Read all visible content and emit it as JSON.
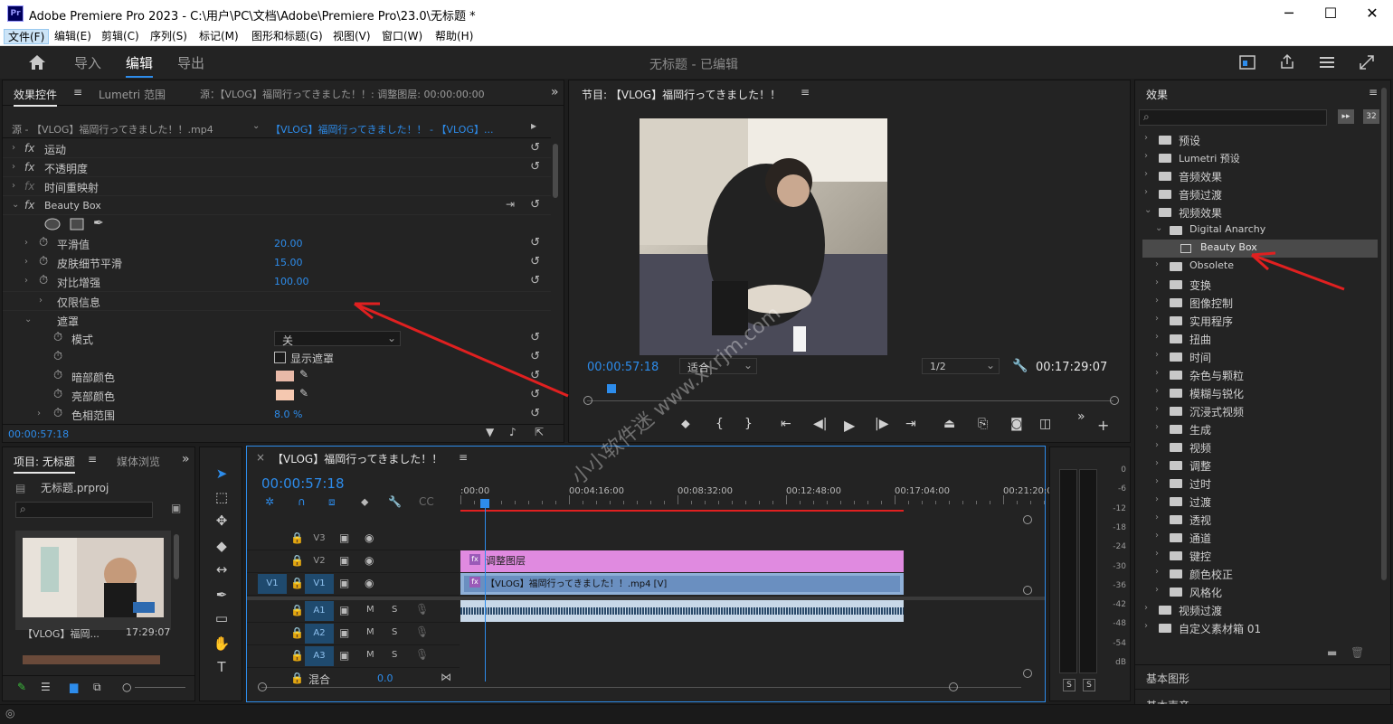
{
  "window": {
    "title": "Adobe Premiere Pro 2023 - C:\\用户\\PC\\文档\\Adobe\\Premiere Pro\\23.0\\无标题 *",
    "app_badge": "Pr"
  },
  "menu": [
    "文件(F)",
    "编辑(E)",
    "剪辑(C)",
    "序列(S)",
    "标记(M)",
    "图形和标题(G)",
    "视图(V)",
    "窗口(W)",
    "帮助(H)"
  ],
  "workspace": {
    "tabs": [
      "导入",
      "编辑",
      "导出"
    ],
    "active_tab": "编辑",
    "project_status": "无标题 - 已编辑"
  },
  "effect_controls": {
    "tabs": [
      "效果控件",
      "Lumetri 范围",
      "源：【VLOG】福岡行ってきました！！: 调整图层: 00:00:00:00"
    ],
    "source_clip": "源 - 【VLOG】福岡行ってきました！！.mp4",
    "sequence_clip": "【VLOG】福岡行ってきました！！ - 【VLOG】...",
    "effects": [
      "运动",
      "不透明度",
      "时间重映射",
      "Beauty Box"
    ],
    "params": [
      {
        "label": "平滑值",
        "value": "20.00"
      },
      {
        "label": "皮肤细节平滑",
        "value": "15.00"
      },
      {
        "label": "对比增强",
        "value": "100.00"
      },
      {
        "label": "仅限信息",
        "value": ""
      },
      {
        "label": "遮罩",
        "value": ""
      },
      {
        "label": "模式",
        "value": "关"
      },
      {
        "label": "",
        "value": "显示遮罩"
      },
      {
        "label": "暗部颜色",
        "value": ""
      },
      {
        "label": "亮部颜色",
        "value": ""
      },
      {
        "label": "色相范围",
        "value": "8.0 %"
      }
    ],
    "timecode": "00:00:57:18",
    "colors": {
      "dark_swatch": "#e8b9a8",
      "light_swatch": "#f5c8b0"
    }
  },
  "program_monitor": {
    "title": "节目: 【VLOG】福岡行ってきました！！",
    "timecode": "00:00:57:18",
    "fit": "适合",
    "resolution": "1/2",
    "duration": "00:17:29:07",
    "playhead_fraction": 0.055
  },
  "project_panel": {
    "tabs": [
      "项目: 无标题",
      "媒体浏览"
    ],
    "file": "无标题.prproj",
    "clip_name": "【VLOG】福岡...",
    "clip_duration": "17:29:07"
  },
  "timeline": {
    "title": "【VLOG】福岡行ってきました！！",
    "timecode": "00:00:57:18",
    "ruler": [
      ":00:00",
      "00:04:16:00",
      "00:08:32:00",
      "00:12:48:00",
      "00:17:04:00",
      "00:21:20:0"
    ],
    "video_tracks": [
      "V3",
      "V2",
      "V1"
    ],
    "audio_tracks": [
      "A1",
      "A2",
      "A3"
    ],
    "source_patch_v": "V1",
    "mix_label": "混合",
    "mix_value": "0.0",
    "clips": {
      "adjustment": "调整图层",
      "video": "【VLOG】福岡行ってきました！！.mp4 [V]"
    },
    "mute_label": "M",
    "solo_label": "S"
  },
  "audio_meter": {
    "ticks": [
      "0",
      "-6",
      "-12",
      "-18",
      "-24",
      "-30",
      "-36",
      "-42",
      "-48",
      "-54",
      "dB"
    ],
    "buttons": [
      "S",
      "S"
    ]
  },
  "effects_panel": {
    "title": "效果",
    "tree": [
      {
        "label": "预设",
        "level": 0,
        "type": "folder"
      },
      {
        "label": "Lumetri 预设",
        "level": 0,
        "type": "folder"
      },
      {
        "label": "音频效果",
        "level": 0,
        "type": "folder"
      },
      {
        "label": "音频过渡",
        "level": 0,
        "type": "folder"
      },
      {
        "label": "视频效果",
        "level": 0,
        "type": "folder",
        "open": true
      },
      {
        "label": "Digital Anarchy",
        "level": 1,
        "type": "folder",
        "open": true
      },
      {
        "label": "Beauty Box",
        "level": 2,
        "type": "effect",
        "selected": true
      },
      {
        "label": "Obsolete",
        "level": 1,
        "type": "folder"
      },
      {
        "label": "变换",
        "level": 1,
        "type": "folder"
      },
      {
        "label": "图像控制",
        "level": 1,
        "type": "folder"
      },
      {
        "label": "实用程序",
        "level": 1,
        "type": "folder"
      },
      {
        "label": "扭曲",
        "level": 1,
        "type": "folder"
      },
      {
        "label": "时间",
        "level": 1,
        "type": "folder"
      },
      {
        "label": "杂色与颗粒",
        "level": 1,
        "type": "folder"
      },
      {
        "label": "模糊与锐化",
        "level": 1,
        "type": "folder"
      },
      {
        "label": "沉浸式视频",
        "level": 1,
        "type": "folder"
      },
      {
        "label": "生成",
        "level": 1,
        "type": "folder"
      },
      {
        "label": "视频",
        "level": 1,
        "type": "folder"
      },
      {
        "label": "调整",
        "level": 1,
        "type": "folder"
      },
      {
        "label": "过时",
        "level": 1,
        "type": "folder"
      },
      {
        "label": "过渡",
        "level": 1,
        "type": "folder"
      },
      {
        "label": "透视",
        "level": 1,
        "type": "folder"
      },
      {
        "label": "通道",
        "level": 1,
        "type": "folder"
      },
      {
        "label": "键控",
        "level": 1,
        "type": "folder"
      },
      {
        "label": "颜色校正",
        "level": 1,
        "type": "folder"
      },
      {
        "label": "风格化",
        "level": 1,
        "type": "folder"
      },
      {
        "label": "视频过渡",
        "level": 0,
        "type": "folder"
      },
      {
        "label": "自定义素材箱 01",
        "level": 0,
        "type": "folder"
      }
    ],
    "bottom_sections": [
      "基本图形",
      "基本声音"
    ]
  },
  "watermark": "小小软件迷 www.xxrjm.com",
  "accent": "#2d8ceb"
}
